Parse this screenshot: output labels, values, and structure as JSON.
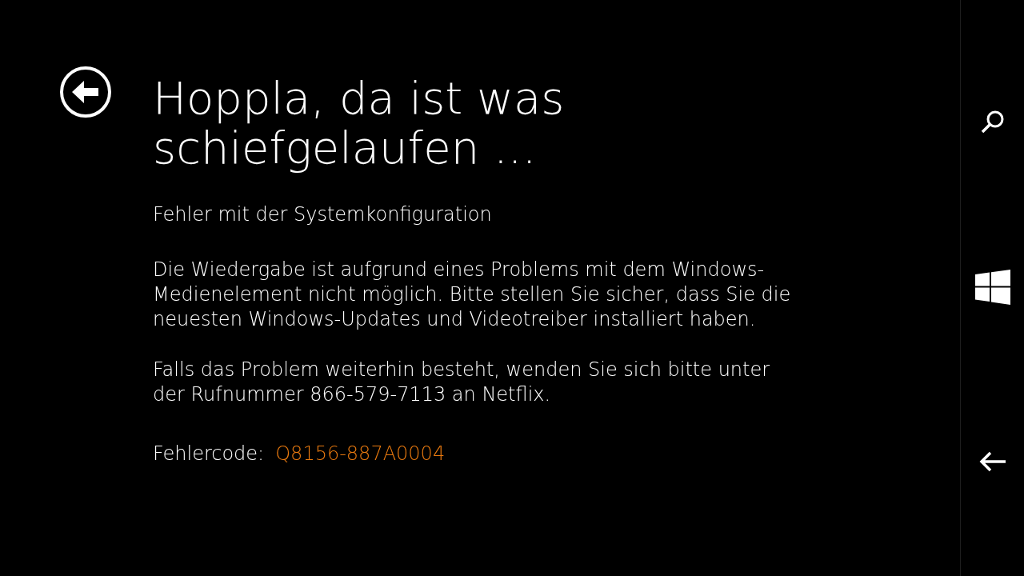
{
  "title": "Hoppla, da ist was schiefgelaufen ...",
  "subtitle": "Fehler mit der Systemkonfiguration",
  "paragraphs": [
    "Die Wiedergabe ist aufgrund eines Problems mit dem Windows-Medienelement nicht möglich. Bitte stellen Sie sicher, dass Sie die neuesten Windows-Updates und Videotreiber installiert haben.",
    "Falls das Problem weiterhin besteht, wenden Sie sich bitte unter der Rufnummer 866-579-7113 an Netflix."
  ],
  "error_code": {
    "label": "Fehlercode:",
    "value": "Q8156-887A0004"
  }
}
